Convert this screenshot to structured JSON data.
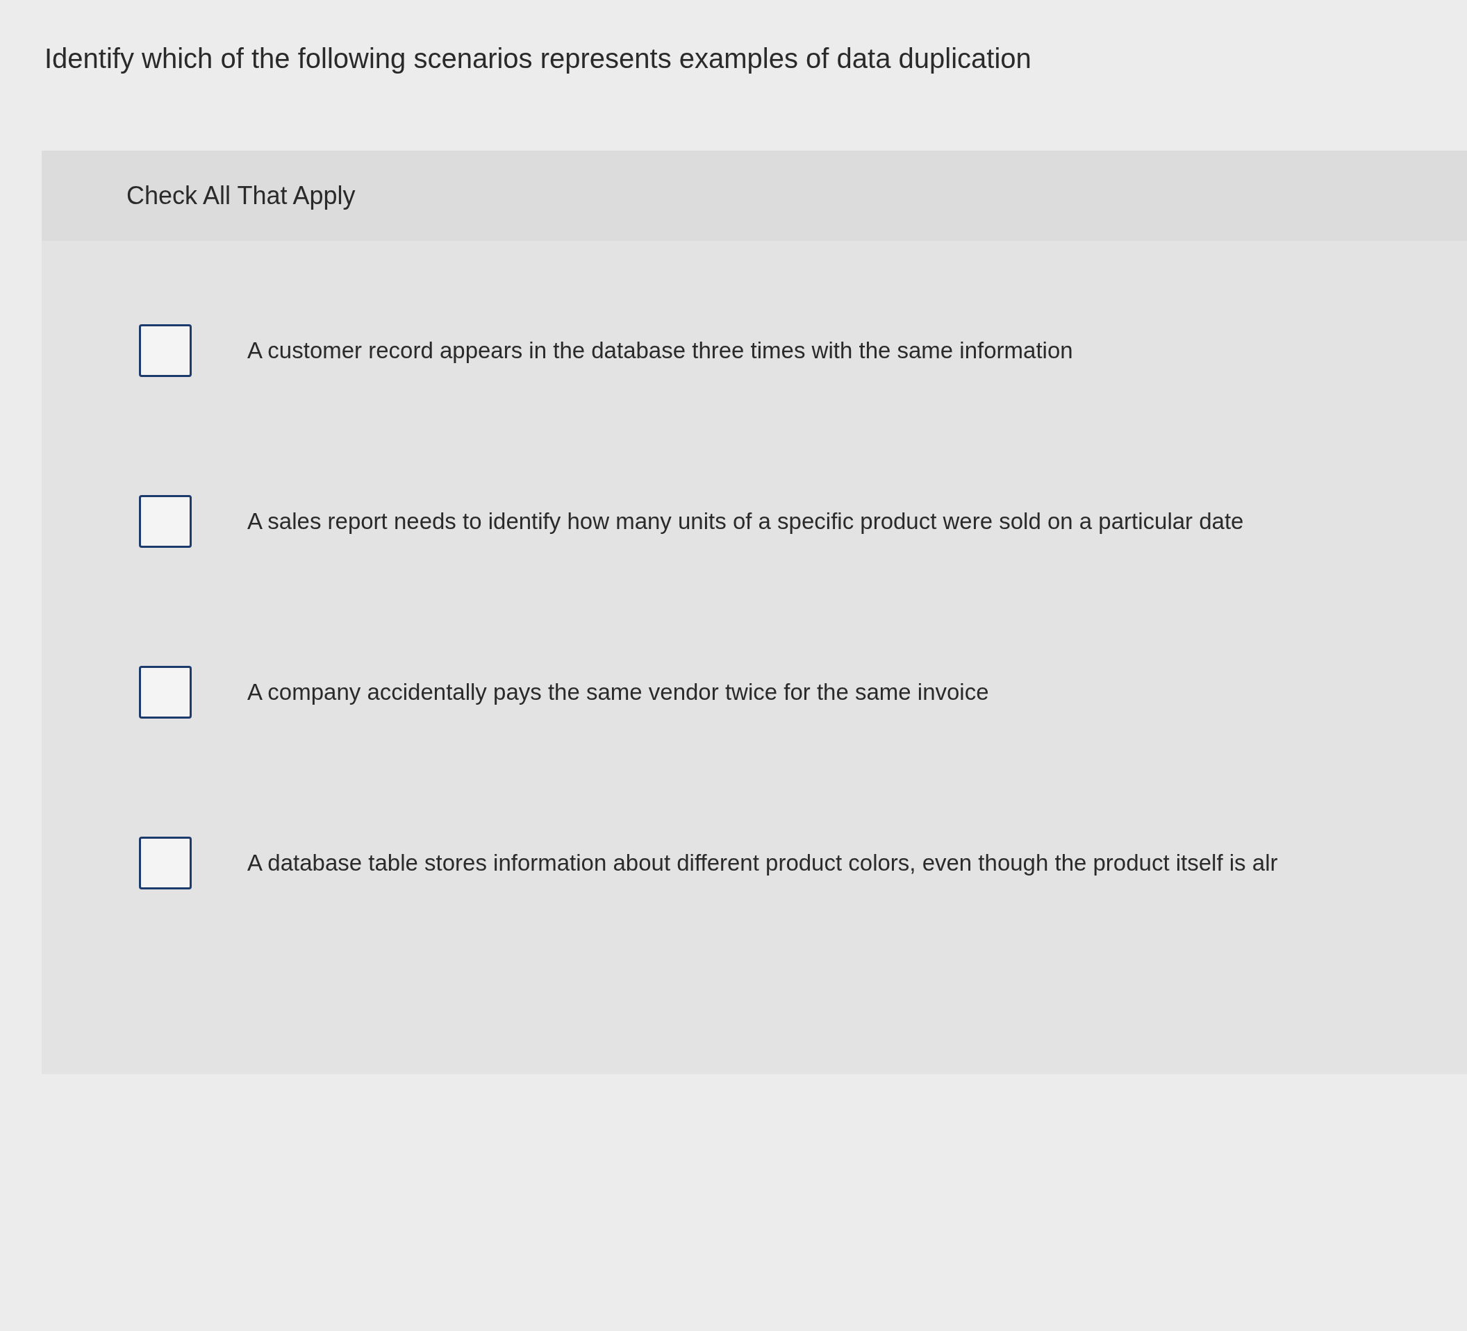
{
  "question": "Identify which of the following scenarios represents examples of data duplication",
  "instruction": "Check All That Apply",
  "options": [
    {
      "label": "A customer record appears in the database three times with the same information",
      "checked": false
    },
    {
      "label": "A sales report needs to identify how many units of a specific product were sold on a particular date",
      "checked": false
    },
    {
      "label": "A company accidentally pays the same vendor twice for the same invoice",
      "checked": false
    },
    {
      "label": "A database table stores information about different product colors, even though the product itself is alr",
      "checked": false
    }
  ]
}
